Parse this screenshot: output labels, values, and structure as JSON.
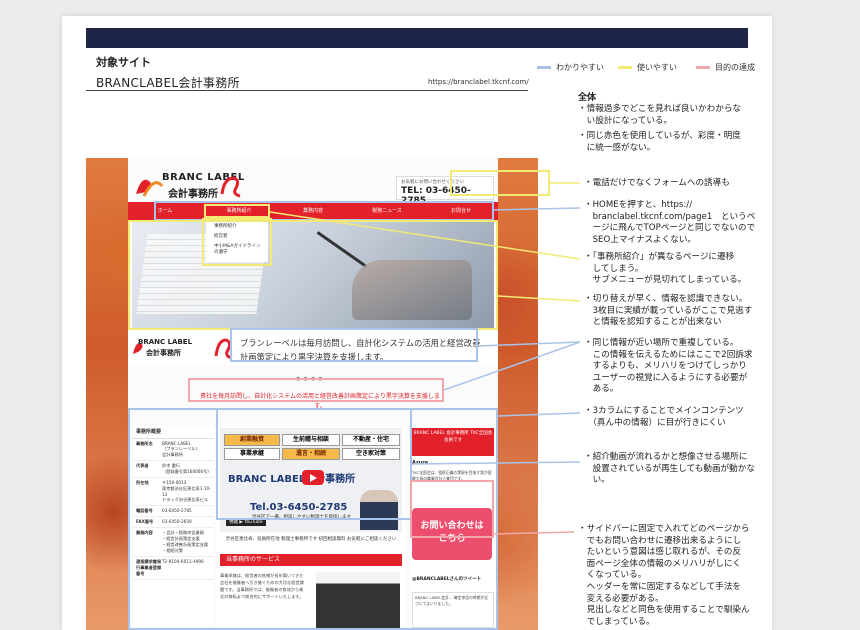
{
  "header": {
    "section_label": "対象サイト",
    "site_name": "BRANCLABEL会計事務所",
    "site_url": "https://branclabel.tkcnf.com/"
  },
  "legend": [
    {
      "label": "わかりやすい",
      "color": "#a9c4ea"
    },
    {
      "label": "使いやすい",
      "color": "#f3ea74"
    },
    {
      "label": "目的の達成",
      "color": "#f2a7ad"
    }
  ],
  "overall": {
    "title": "全体",
    "items": [
      "・情報過多でどこを見れば良いかわからな\n　い設計になっている。",
      "・同じ赤色を使用しているが、彩度・明度\n　に統一感がない。"
    ]
  },
  "notes": [
    "・電話だけでなくフォームへの誘導も",
    "・HOMEを押すと、https://\n　branclabel.tkcnf.com/page1　というペ\n　ージに飛んでTOPページと同じでないので\n　SEO上マイナスよくない。",
    "・「事務所紹介」が異なるページに遷移\n　してしまう。\n　サブメニューが見切れてしまっている。",
    "・切り替えが早く、情報を認識できない。\n　3枚目に実績が載っているがここで見逃す\n　と情報を認知することが出来ない",
    "・同じ情報が近い場所で重複している。\n　この情報を伝えるためにはここで2回訴求\n　するよりも、メリハリをつけてしっかり\n　ユーザーの視覚に入るようにする必要が\n　ある。",
    "・3カラムにすることでメインコンテンツ\n　（真ん中の情報）に目が行きにくい",
    "・紹介動画が流れるかと想像させる場所に\n　設置されているが再生しても動画が動かな\n　い。",
    "・サイドバーに固定で入れてどのページから\n　でもお問い合わせに遷移出来るようにし\n　たいという意図は感じ取れるが、その反\n　面ページ全体の情報のメリハリがしにく\n　くなっている。\n　ヘッダーを常に固定するなどして手法を\n　変える必要がある。\n　見出しなどと同色を使用することで馴染ん\n　でしまっている。"
  ],
  "site": {
    "logo_line1": "BRANC LABEL",
    "logo_line2": "会計事務所",
    "tel_caption": "お気軽にお問い合わせください",
    "tel_number": "TEL: 03-6450-2785",
    "nav": [
      "ホーム",
      "事務所紹介",
      "業務内容",
      "税務ニュース",
      "お問合せ"
    ],
    "dropdown": [
      "事務所紹介",
      "経営者",
      "中小M&Aガイドラインの遵守"
    ],
    "slide_logo1": "BRANC LABEL",
    "slide_logo2": "会計事務所",
    "slide_text": "ブランレーベルは毎月訪問し、自計化システムの活用と経営改善計画策定により黒字決算を支援します。",
    "dots": "●●●●",
    "tagline": "貴社を毎月訪問し、自計化システムの活用と経営改善計画策定により黒字決算を支援します。",
    "left_sidebar": {
      "title": "事務所概要",
      "rows": [
        {
          "k": "事務所名",
          "v": "BRANC LABEL\n（ブランレーベル）\n会計事務所"
        },
        {
          "k": "代表者",
          "v": "鈴木 重行\n（登録番号第160006号）"
        },
        {
          "k": "所在地",
          "v": "〒150-0013\n東京都渋谷区恵比寿1-10-13\nドラッグ渋谷恵比寿ビル"
        },
        {
          "k": "電話番号",
          "v": "03-6450-2785"
        },
        {
          "k": "FAX番号",
          "v": "03-6450-2659"
        },
        {
          "k": "業務内容",
          "v": "・会計・税務申告業務\n・経営計画策定支援\n・経営改善計画策定支援\n・相続対策"
        },
        {
          "k": "適格請求書発行事業者登録番号",
          "v": "T2-9104-6011-4990"
        }
      ]
    },
    "video": {
      "buttons": [
        "創業融資",
        "生前贈与相談",
        "不動産・住宅",
        "事業承継",
        "遺言・相続",
        "空き家対策"
      ],
      "logo": "BRANC LABEL会計事務所",
      "tel": "Tel.03-6450-2785",
      "sub": "渋谷区で一番、相談しやすい税理士を目指します",
      "yt": "視聴 ▶ YouTube"
    },
    "main_text": "渋谷区恵比寿、役員所在地 税理士事務所です 初回相談無料 お気軽にご相談ください",
    "services_title": "当事務所のサービス",
    "services_text": "事業承継は、経営者の皆様が長年築いてきた会社を後継者へ引き継ぐための大切な経営課題です。当事務所では、後継者の育成から株式の移転まで総合的にサポートいたします。",
    "right_sidebar": {
      "red_box": "BRANC LABEL 会計事務所 TKC全国会会員です",
      "head": "Azure",
      "text": "TKC全国会は、租税正義の実現を目指す我が国最大級の職業会計人集団です。",
      "contact_l1": "お問い合わせは",
      "contact_l2": "こちら",
      "twitter_head": "@BRANCLABELさんのツイート",
      "twitter_text": "BRANC LABEL会計… 確定申告の時期が近づいてまいりました。"
    }
  }
}
